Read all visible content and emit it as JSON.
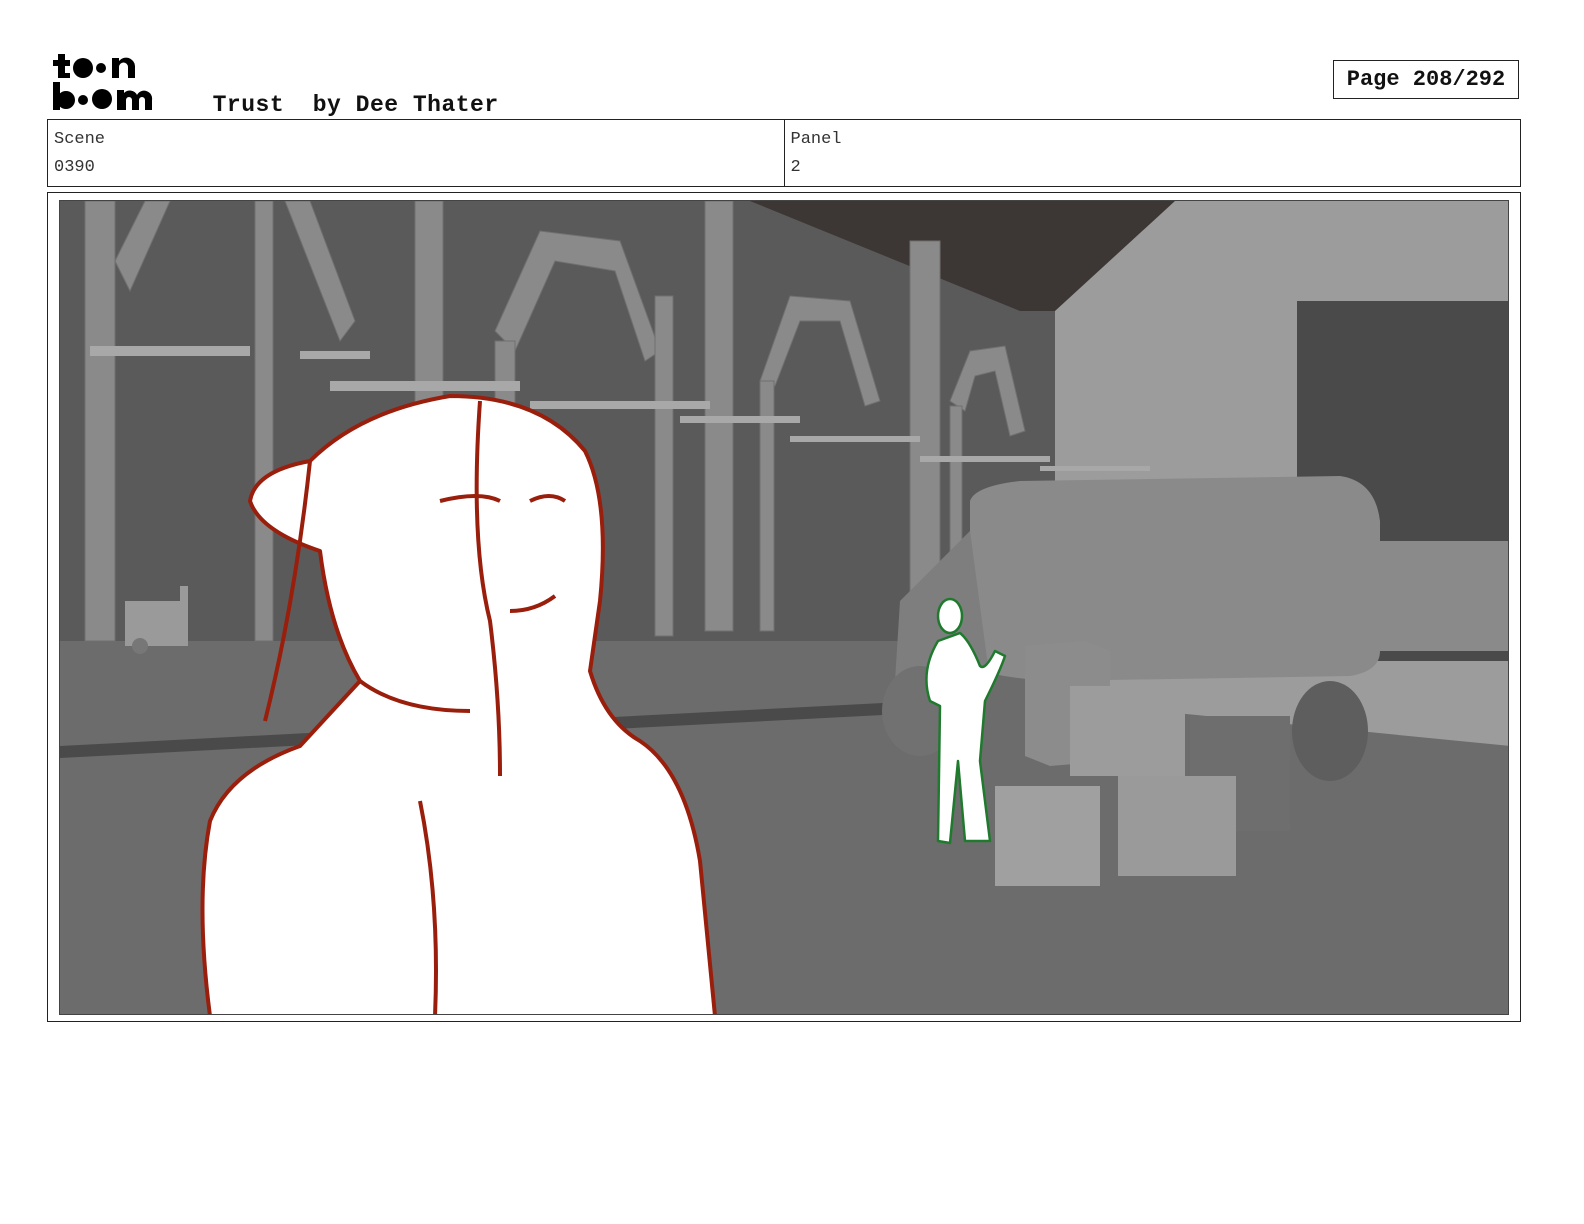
{
  "header": {
    "logo_text": "toon boom",
    "title": "Trust",
    "author": "by Dee Thater",
    "page_label": "Page 208/292"
  },
  "info": {
    "scene_label": "Scene",
    "scene_value": "0390",
    "panel_label": "Panel",
    "panel_value": "2"
  },
  "colors": {
    "foreground_character_line": "#9a1e0c",
    "background_character_line": "#1f7a2e",
    "border": "#222222"
  }
}
